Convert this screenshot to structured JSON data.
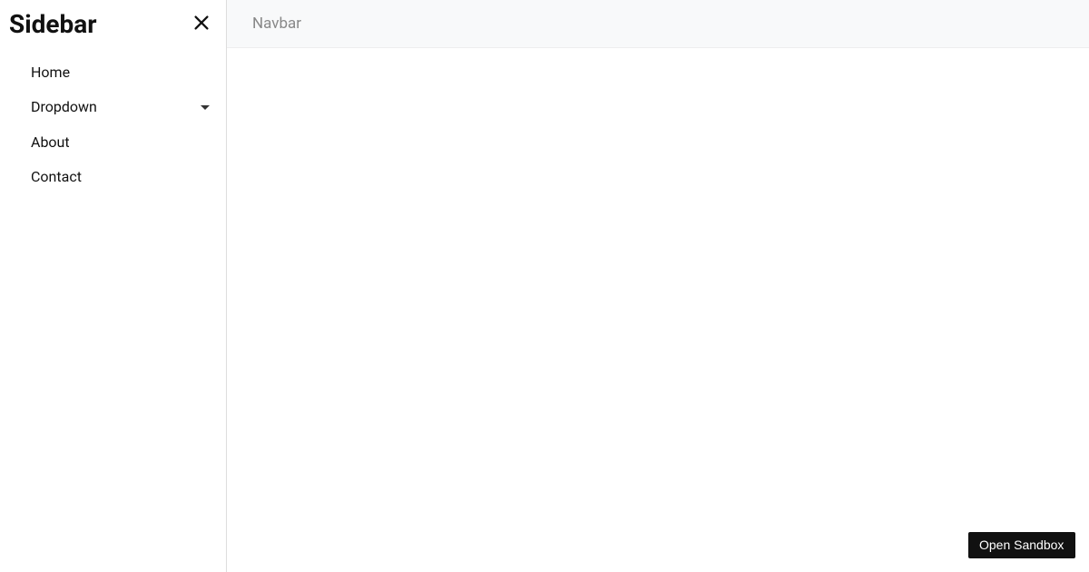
{
  "sidebar": {
    "title": "Sidebar",
    "items": [
      {
        "label": "Home",
        "hasDropdown": false
      },
      {
        "label": "Dropdown",
        "hasDropdown": true
      },
      {
        "label": "About",
        "hasDropdown": false
      },
      {
        "label": "Contact",
        "hasDropdown": false
      }
    ]
  },
  "navbar": {
    "brand": "Navbar"
  },
  "actions": {
    "open_sandbox": "Open Sandbox"
  }
}
